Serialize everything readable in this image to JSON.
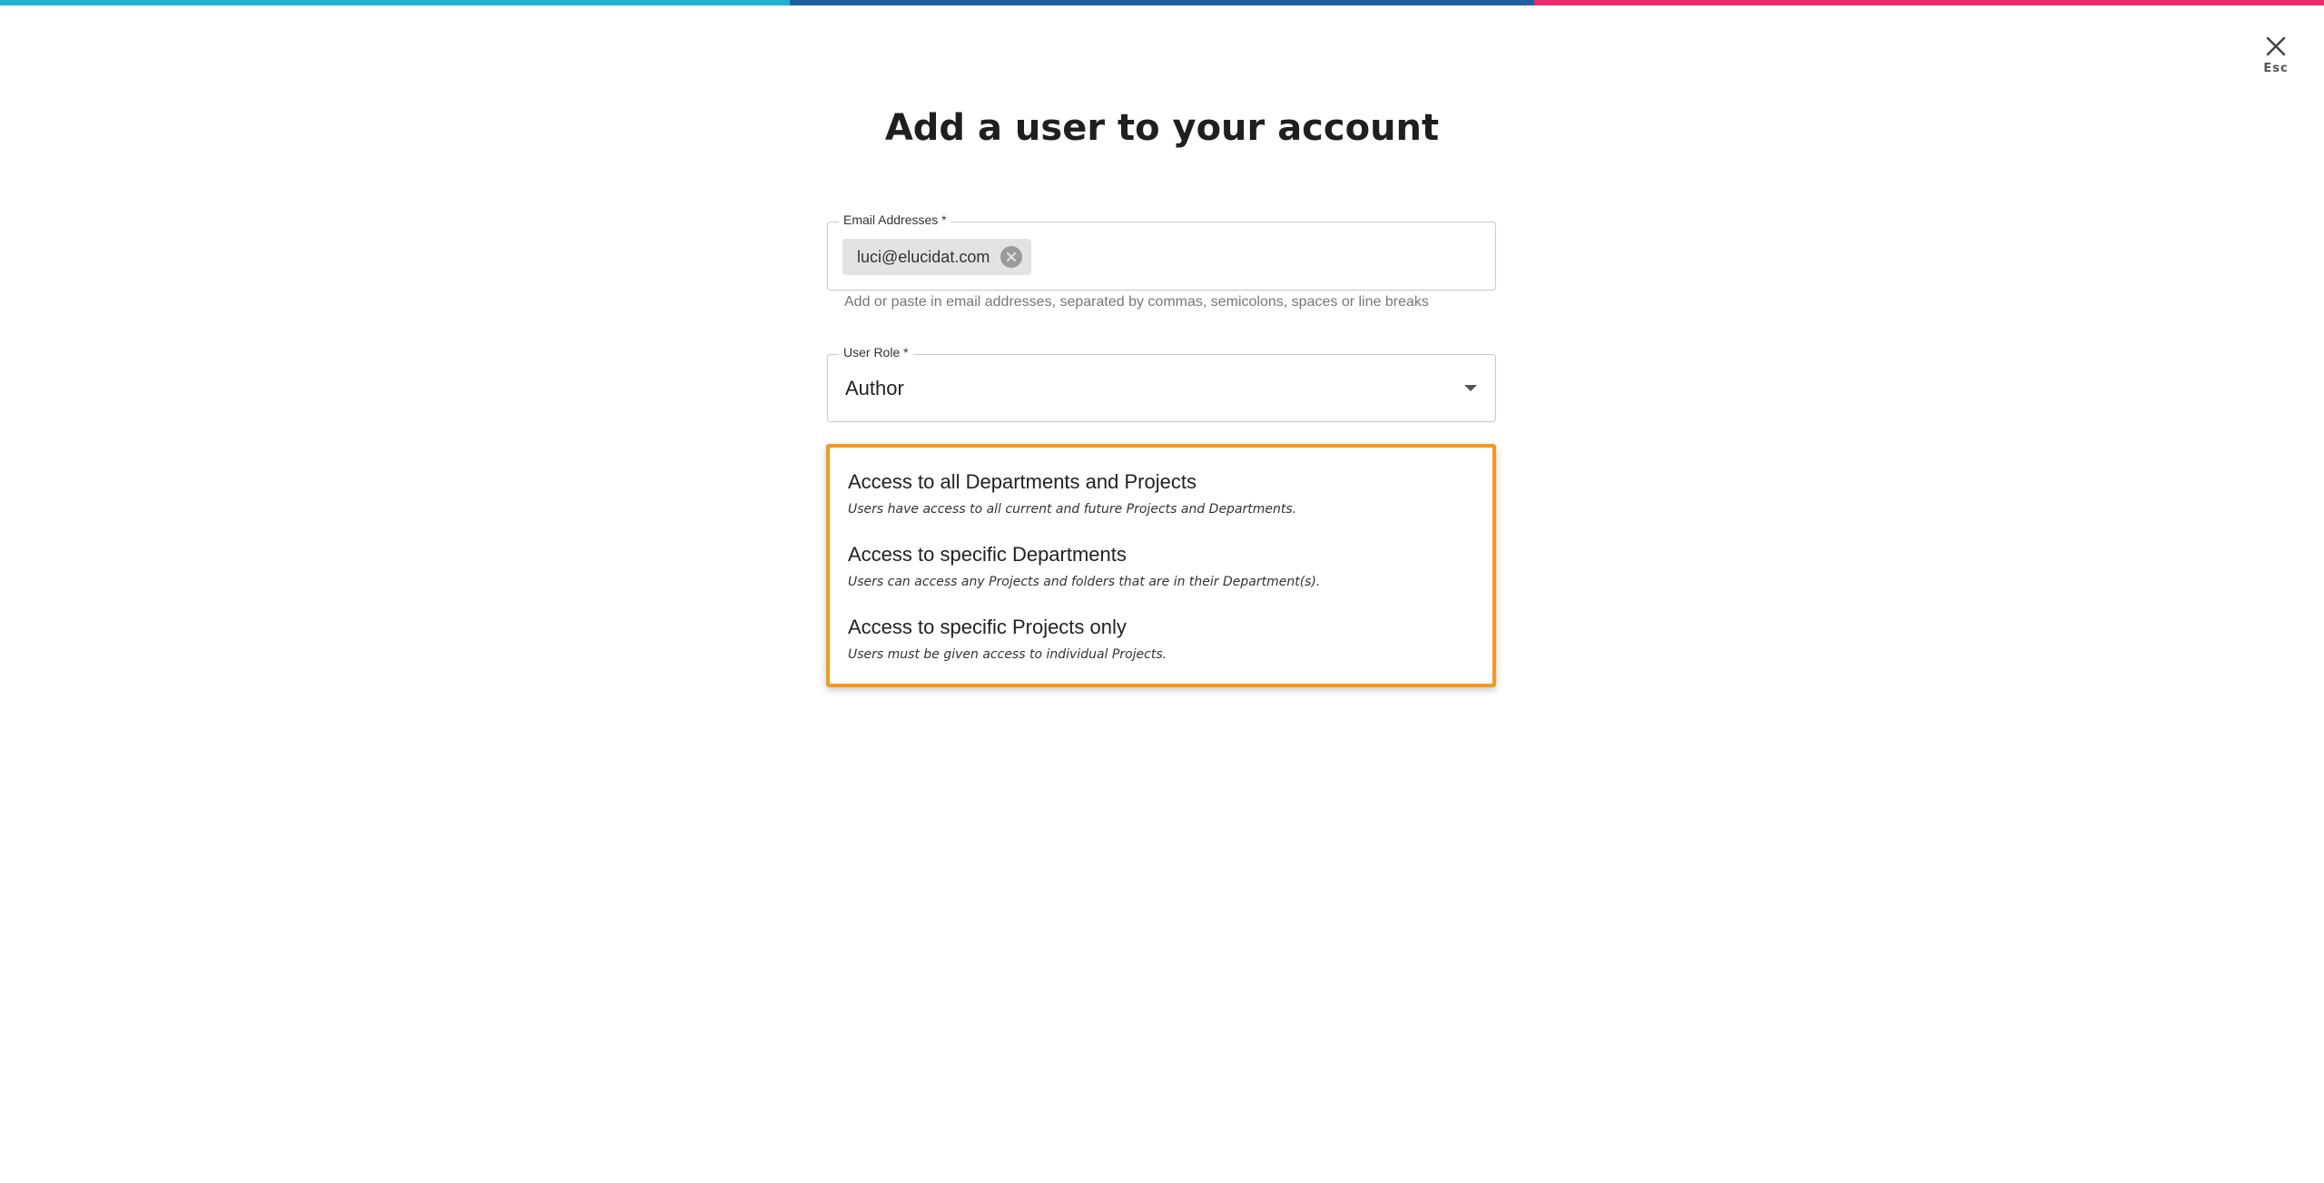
{
  "topbar": {
    "colors": [
      "#1fb3d1",
      "#1e5fa0",
      "#ee2a6f"
    ]
  },
  "close": {
    "icon": "close-icon",
    "label": "Esc"
  },
  "title": "Add a user to your account",
  "email_field": {
    "label": "Email Addresses *",
    "chips": [
      "luci@elucidat.com"
    ],
    "chip_remove_icon": "remove-circle-icon",
    "helper": "Add or paste in email addresses, separated by commas, semicolons, spaces or line breaks"
  },
  "role_field": {
    "label": "User Role *",
    "value": "Author",
    "dropdown_icon": "caret-down-icon"
  },
  "access": {
    "highlight_color": "#f39a1e",
    "options": [
      {
        "title": "Access to all Departments and Projects",
        "description": "Users have access to all current and future Projects and Departments."
      },
      {
        "title": "Access to specific Departments",
        "description": "Users can access any Projects and folders that are in their Department(s)."
      },
      {
        "title": "Access to specific Projects only",
        "description": "Users must be given access to individual Projects."
      }
    ]
  }
}
